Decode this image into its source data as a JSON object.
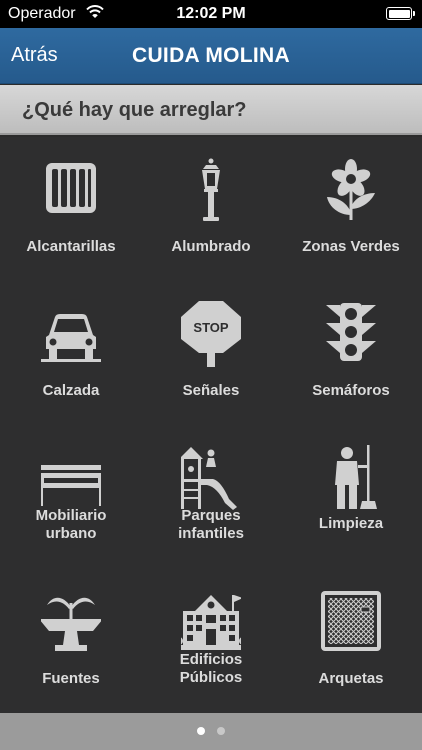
{
  "status_bar": {
    "carrier": "Operador",
    "time": "12:02 PM"
  },
  "nav": {
    "back_label": "Atrás",
    "title": "CUIDA MOLINA"
  },
  "section": {
    "title": "¿Qué hay que arreglar?"
  },
  "categories": [
    {
      "label": "Alcantarillas",
      "icon": "sewer-grate-icon"
    },
    {
      "label": "Alumbrado",
      "icon": "street-lamp-icon"
    },
    {
      "label": "Zonas Verdes",
      "icon": "flower-icon"
    },
    {
      "label": "Calzada",
      "icon": "car-road-icon"
    },
    {
      "label": "Señales",
      "icon": "stop-sign-icon",
      "sign_text": "STOP"
    },
    {
      "label": "Semáforos",
      "icon": "traffic-light-icon"
    },
    {
      "label_line1": "Mobiliario",
      "label_line2": "urbano",
      "icon": "bench-icon"
    },
    {
      "label_line1": "Parques",
      "label_line2": "infantiles",
      "icon": "playground-icon"
    },
    {
      "label": "Limpieza",
      "icon": "street-sweeper-icon"
    },
    {
      "label": "Fuentes",
      "icon": "fountain-icon"
    },
    {
      "label_line1": "Edificios",
      "label_line2": "Públicos",
      "icon": "public-building-icon"
    },
    {
      "label": "Arquetas",
      "icon": "manhole-cover-icon"
    }
  ],
  "pagination": {
    "pages": 2,
    "current": 1
  },
  "colors": {
    "nav_bar": "#2f6aa0",
    "grid_bg": "#2e2e2f",
    "icon": "#d0d0d0",
    "label": "#dcdcdc"
  }
}
